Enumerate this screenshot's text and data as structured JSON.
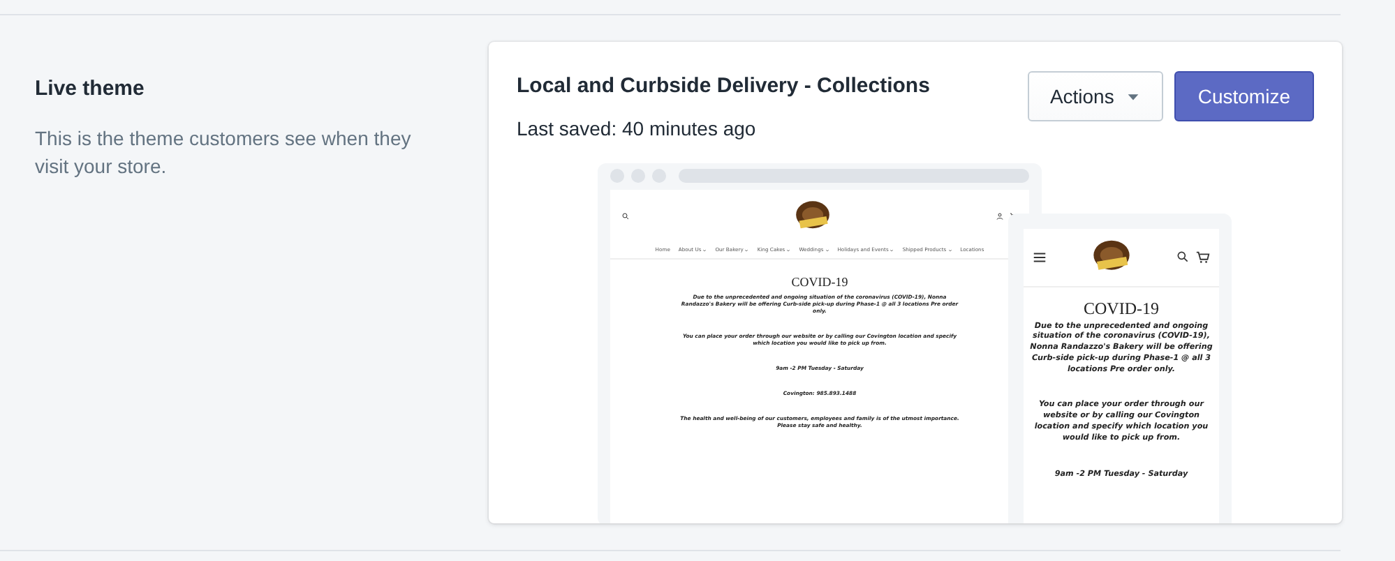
{
  "section": {
    "title": "Live theme",
    "description": "This is the theme customers see when they visit your store."
  },
  "theme": {
    "name": "Local and Curbside Delivery - Collections",
    "last_saved": "Last saved: 40 minutes ago",
    "buttons": [
      {
        "label": "Actions",
        "kind": "dropdown"
      },
      {
        "label": "Customize",
        "kind": "primary"
      }
    ]
  },
  "preview": {
    "desktop": {
      "nav": [
        {
          "label": "Home",
          "has_menu": false
        },
        {
          "label": "About Us",
          "has_menu": true
        },
        {
          "label": "Our Bakery",
          "has_menu": true
        },
        {
          "label": "King Cakes",
          "has_menu": true
        },
        {
          "label": "Weddings",
          "has_menu": true
        },
        {
          "label": "Holidays and Events",
          "has_menu": true
        },
        {
          "label": "Shipped Products",
          "has_menu": true
        },
        {
          "label": "Locations",
          "has_menu": false
        }
      ],
      "heading": "COVID-19",
      "paragraphs": [
        "Due to the unprecedented and ongoing situation of the coronavirus (COVID-19), Nonna Randazzo's Bakery will be offering Curb-side pick-up during Phase-1 @ all 3 locations Pre order only.",
        "You can place your order through our website or by calling our Covington location and specify which location you would like to pick up from.",
        "9am -2 PM Tuesday - Saturday",
        "Covington: 985.893.1488",
        "The health and well-being of our customers, employees and family is of the utmost importance. Please stay safe and healthy."
      ]
    },
    "mobile": {
      "heading": "COVID-19",
      "paragraphs": [
        "Due to the unprecedented and ongoing situation of the coronavirus (COVID-19), Nonna Randazzo's Bakery will be offering Curb-side pick-up during Phase-1 @ all 3 locations Pre order only.",
        "You can place your order through our website or by calling our Covington location and specify which location you would like to pick up from.",
        "9am -2 PM Tuesday - Saturday"
      ]
    }
  }
}
